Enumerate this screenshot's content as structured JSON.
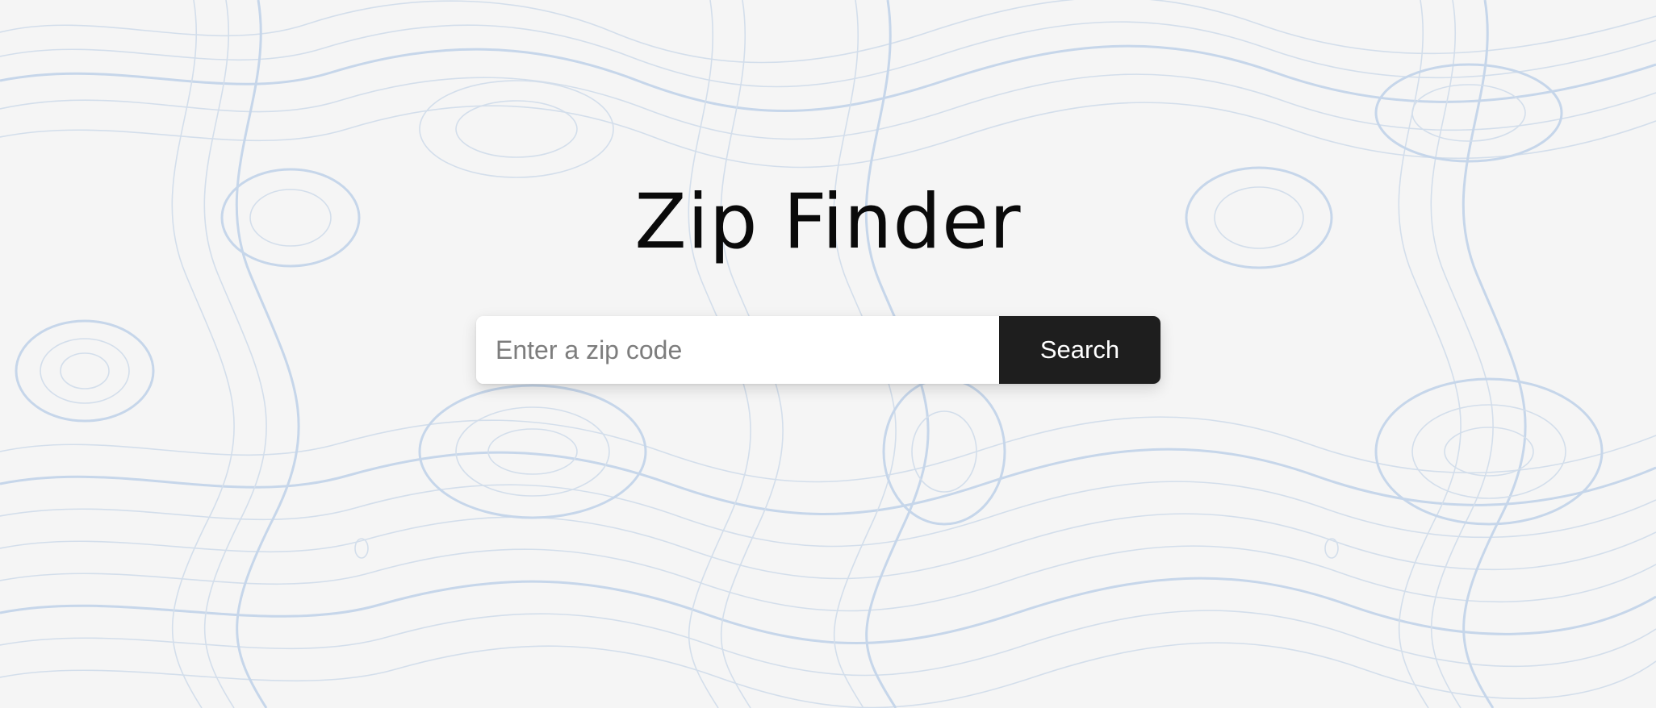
{
  "app": {
    "title": "Zip Finder"
  },
  "search": {
    "placeholder": "Enter a zip code",
    "value": "",
    "button_label": "Search"
  },
  "theme": {
    "background": "#f5f5f5",
    "contour_color": "#d3deeb",
    "button_color": "#1e1e1e",
    "button_text_color": "#ffffff",
    "title_color": "#0a0a0a"
  },
  "icons": {
    "background_pattern": "topographic-contour-lines"
  }
}
